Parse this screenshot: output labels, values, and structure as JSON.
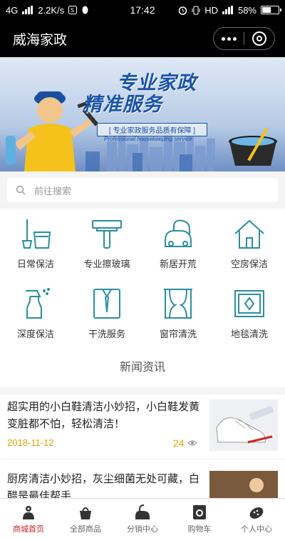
{
  "status_bar": {
    "network": "4G",
    "speed": "2.2K/s",
    "time": "17:42",
    "indicators": "HD",
    "battery_level": "58%",
    "battery_fraction": 0.58
  },
  "title_bar": {
    "title": "威海家政",
    "menu_icon": "more-dots-icon",
    "close_icon": "close-circle-icon"
  },
  "banner": {
    "headline_line1": "专业家政",
    "headline_line2": "精准服务",
    "tagline": "[ 专业家政服务品质有保障 ]",
    "tagline_en": "Professional housekeeping service"
  },
  "search": {
    "placeholder": "前往搜索"
  },
  "services": [
    {
      "label": "日常保洁",
      "icon": "mop-bucket-icon"
    },
    {
      "label": "专业擦玻璃",
      "icon": "squeegee-icon"
    },
    {
      "label": "新居开荒",
      "icon": "vacuum-icon"
    },
    {
      "label": "空房保洁",
      "icon": "house-icon"
    },
    {
      "label": "深度保洁",
      "icon": "spray-bottle-icon"
    },
    {
      "label": "干洗服务",
      "icon": "shirt-icon"
    },
    {
      "label": "窗帘清洗",
      "icon": "curtain-icon"
    },
    {
      "label": "地毯清洗",
      "icon": "carpet-icon"
    }
  ],
  "news": {
    "heading": "新闻资讯",
    "articles": [
      {
        "title": "超实用的小白鞋清洁小妙招，小白鞋发黄变脏都不怕，轻松清洁！",
        "date": "2018-11-12",
        "views": "24"
      },
      {
        "title": "厨房清洁小妙招，灰尘细菌无处可藏，白醋是最佳帮手",
        "date": "",
        "views": ""
      }
    ]
  },
  "tab_bar": {
    "tabs": [
      {
        "label": "商城首页",
        "icon": "home-person-icon",
        "active": true
      },
      {
        "label": "全部商品",
        "icon": "basket-icon",
        "active": false
      },
      {
        "label": "分销中心",
        "icon": "vacuum-icon",
        "active": false
      },
      {
        "label": "购物车",
        "icon": "washing-machine-icon",
        "active": false
      },
      {
        "label": "个人中心",
        "icon": "sponge-icon",
        "active": false
      }
    ]
  },
  "colors": {
    "accent": "#d32222",
    "icon_teal": "#2a8fa0",
    "date_orange": "#e2a200"
  }
}
